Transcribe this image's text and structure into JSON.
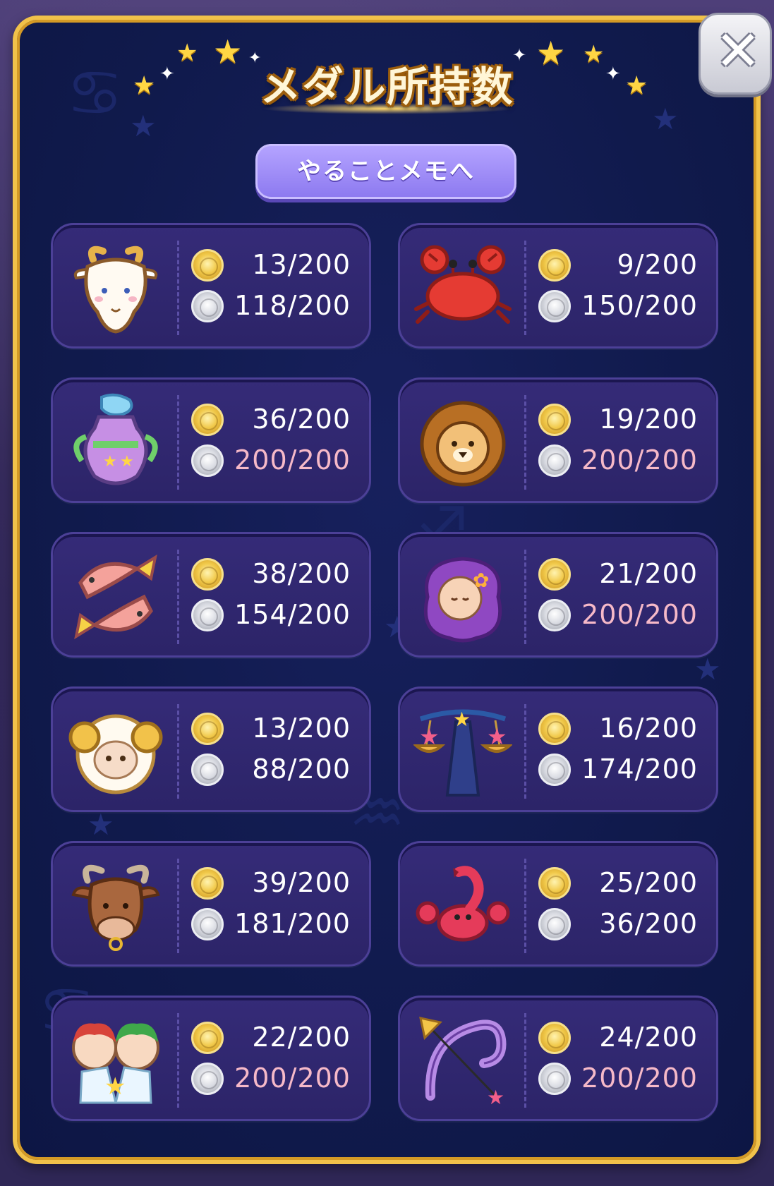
{
  "dialog": {
    "title": "メダル所持数",
    "memo_button_label": "やることメモへ",
    "close_icon": "close-icon",
    "colors": {
      "panel_bg": "#101a4c",
      "panel_border": "#f1c24a",
      "card_bg": "#2f2670",
      "count_text": "#ffffff",
      "count_full_text": "#f6b9c8",
      "memo_button_bg": "#9c8bf5"
    }
  },
  "medals": [
    {
      "sign": "capricorn-goat",
      "icon": "goat-icon",
      "gold": "13/200",
      "silver": "118/200",
      "gold_full": false,
      "silver_full": false
    },
    {
      "sign": "cancer-crab",
      "icon": "crab-icon",
      "gold": "9/200",
      "silver": "150/200",
      "gold_full": false,
      "silver_full": false
    },
    {
      "sign": "aquarius-urn",
      "icon": "water-urn-icon",
      "gold": "36/200",
      "silver": "200/200",
      "gold_full": false,
      "silver_full": true
    },
    {
      "sign": "leo-lion",
      "icon": "lion-icon",
      "gold": "19/200",
      "silver": "200/200",
      "gold_full": false,
      "silver_full": true
    },
    {
      "sign": "pisces-fish",
      "icon": "fish-icon",
      "gold": "38/200",
      "silver": "154/200",
      "gold_full": false,
      "silver_full": false
    },
    {
      "sign": "virgo-maiden",
      "icon": "maiden-icon",
      "gold": "21/200",
      "silver": "200/200",
      "gold_full": false,
      "silver_full": true
    },
    {
      "sign": "aries-ram",
      "icon": "ram-icon",
      "gold": "13/200",
      "silver": "88/200",
      "gold_full": false,
      "silver_full": false
    },
    {
      "sign": "libra-scales",
      "icon": "scales-icon",
      "gold": "16/200",
      "silver": "174/200",
      "gold_full": false,
      "silver_full": false
    },
    {
      "sign": "taurus-bull",
      "icon": "bull-icon",
      "gold": "39/200",
      "silver": "181/200",
      "gold_full": false,
      "silver_full": false
    },
    {
      "sign": "scorpio-scorpion",
      "icon": "scorpion-icon",
      "gold": "25/200",
      "silver": "36/200",
      "gold_full": false,
      "silver_full": false
    },
    {
      "sign": "gemini-twins",
      "icon": "twins-icon",
      "gold": "22/200",
      "silver": "200/200",
      "gold_full": false,
      "silver_full": true
    },
    {
      "sign": "sagittarius-bow",
      "icon": "bow-arrow-icon",
      "gold": "24/200",
      "silver": "200/200",
      "gold_full": false,
      "silver_full": true
    }
  ]
}
